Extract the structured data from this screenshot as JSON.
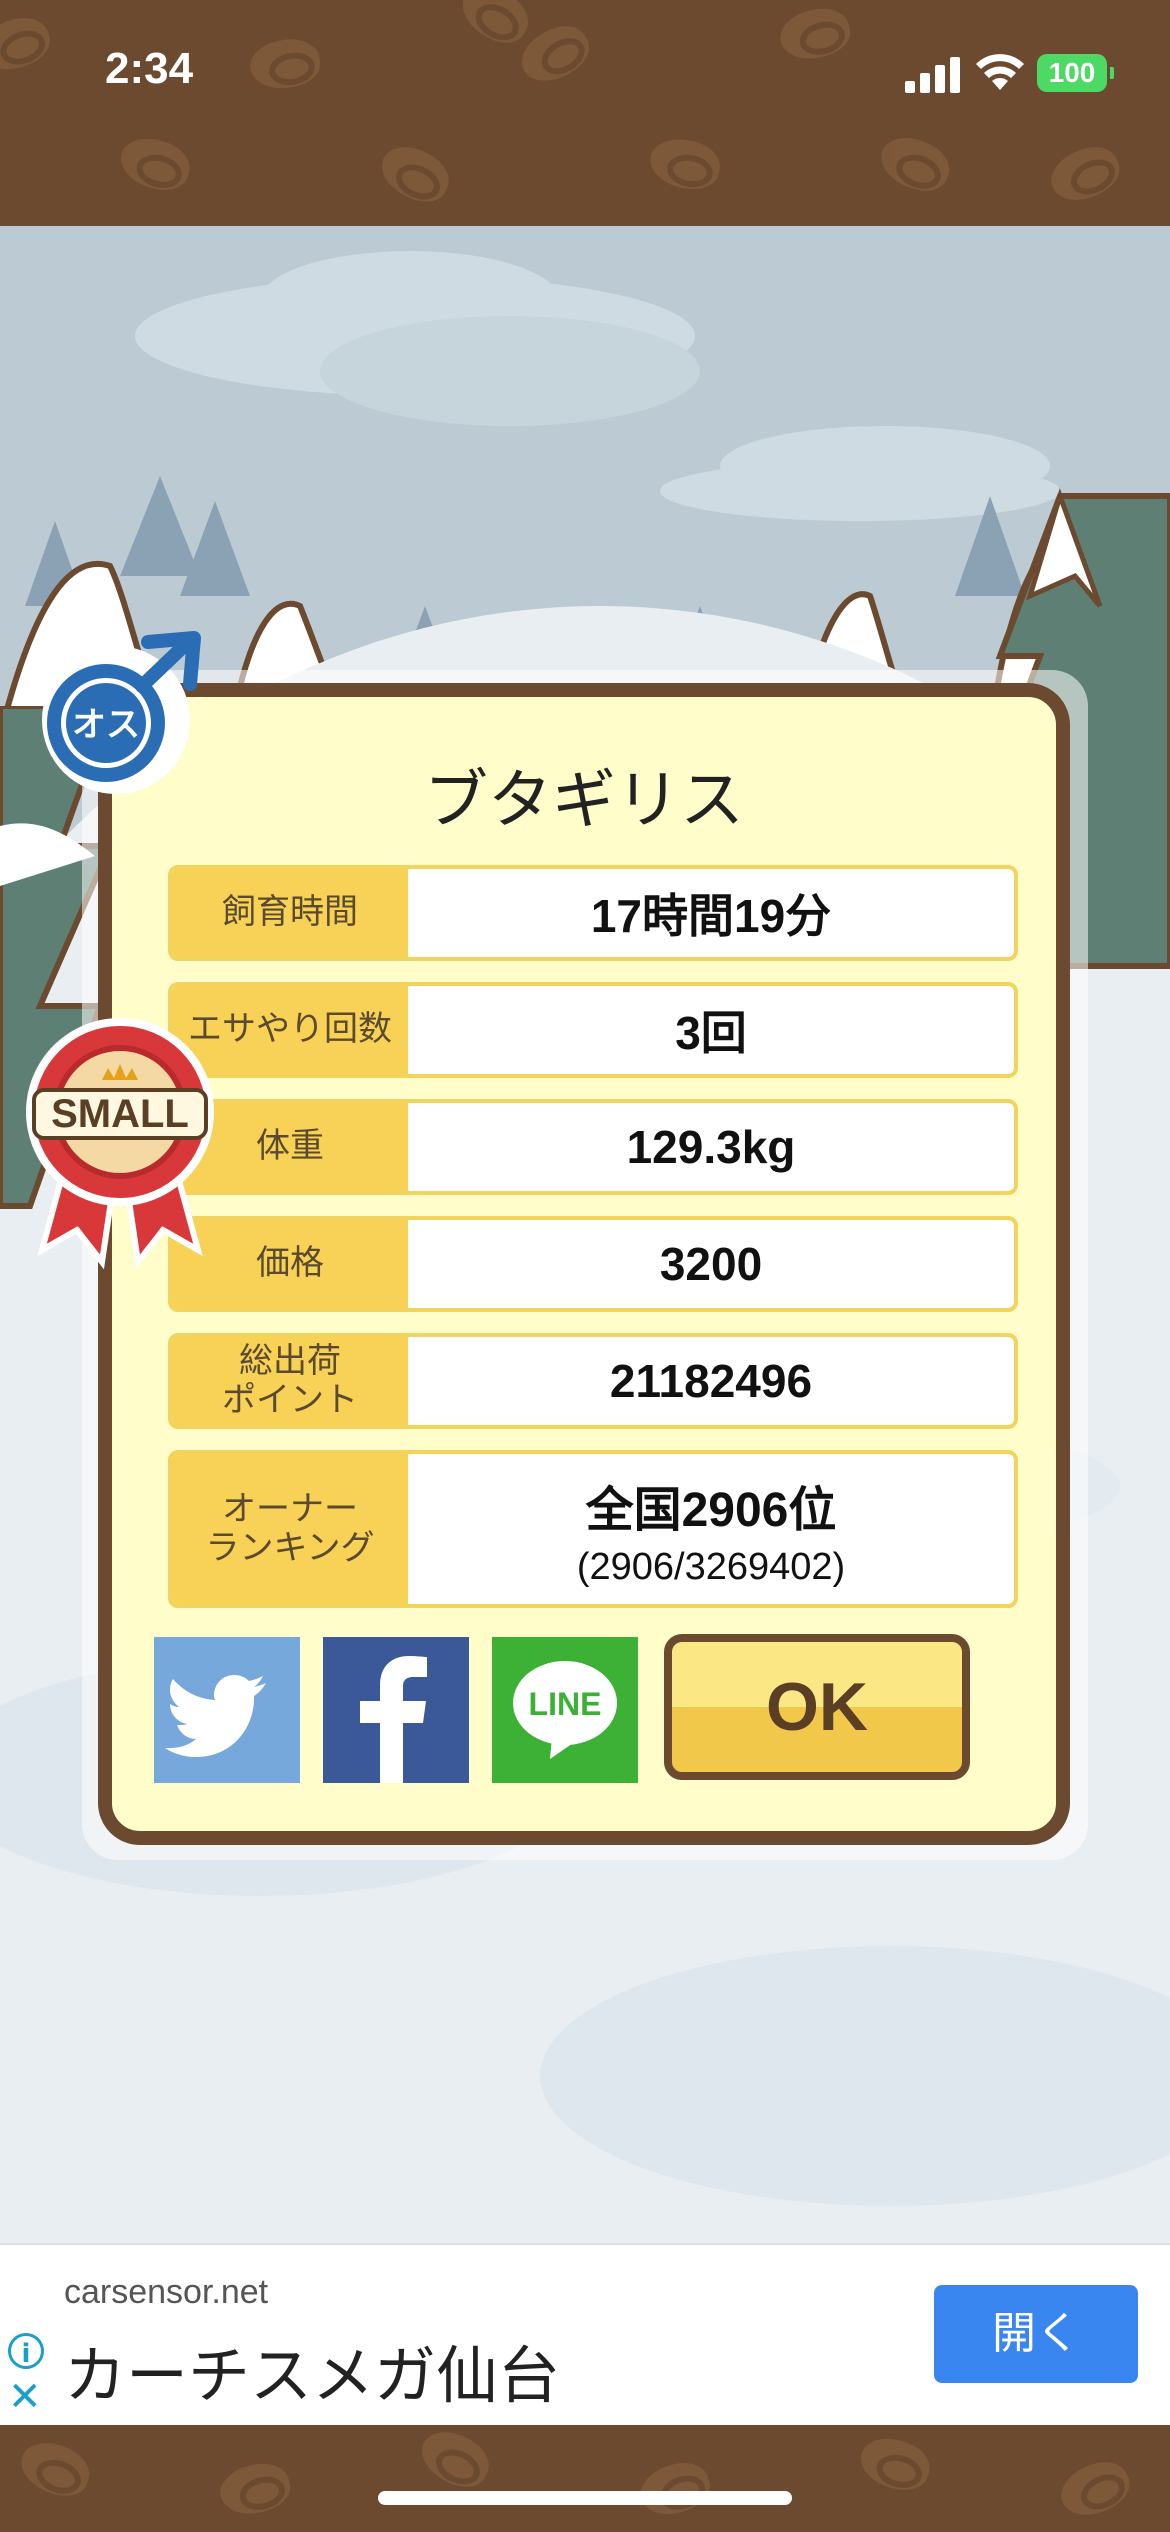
{
  "status_bar": {
    "time": "2:34",
    "battery": "100"
  },
  "card": {
    "title": "ブタギリス",
    "rows": [
      {
        "label": "飼育時間",
        "value": "17時間19分"
      },
      {
        "label": "エサやり回数",
        "value": "3回"
      },
      {
        "label": "体重",
        "value": "129.3kg"
      },
      {
        "label": "価格",
        "value": "3200"
      },
      {
        "label": "総出荷\nポイント",
        "value": "21182496"
      },
      {
        "label": "オーナー\nランキング",
        "value": "全国2906位",
        "sub": "(2906/3269402)"
      }
    ],
    "ok_label": "OK",
    "social": {
      "twitter": "twitter-icon",
      "facebook": "facebook-icon",
      "line_text": "LINE"
    }
  },
  "gender_badge": {
    "text": "オス",
    "icon": "male-symbol-icon",
    "color": "#2a6db5"
  },
  "size_ribbon": {
    "text": "SMALL",
    "color": "#d9383a"
  },
  "ad": {
    "domain": "carsensor.net",
    "title": "カーチスメガ仙台",
    "button": "開く"
  }
}
